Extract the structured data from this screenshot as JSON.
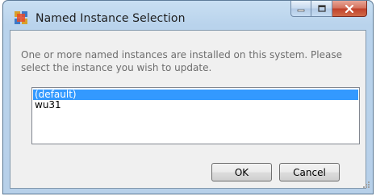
{
  "window": {
    "title": "Named Instance Selection"
  },
  "dialog": {
    "prompt": "One or more named instances are installed on this system. Please select the instance you wish to update."
  },
  "instances": {
    "items": [
      {
        "label": "(default)",
        "selected": true
      },
      {
        "label": "wu31",
        "selected": false
      }
    ]
  },
  "buttons": {
    "ok_label": "OK",
    "cancel_label": "Cancel"
  },
  "colors": {
    "selection": "#3399ff",
    "close_button": "#c0402a"
  },
  "icons": {
    "app": "application-icon",
    "minimize": "minimize-icon",
    "maximize": "maximize-icon",
    "close": "close-icon",
    "grip": "resize-grip-icon"
  }
}
